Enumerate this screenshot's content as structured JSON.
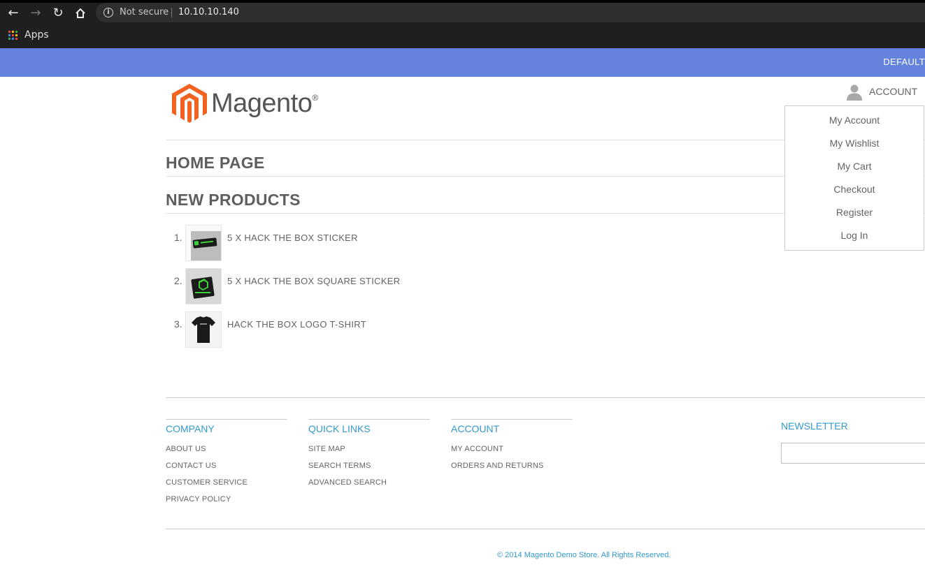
{
  "browser": {
    "security_label": "Not secure",
    "url": "10.10.10.140",
    "bookmarks": {
      "apps_label": "Apps"
    }
  },
  "header": {
    "store_language": "DEFAULT",
    "logo_text": "Magento",
    "logo_reg": "®",
    "account_label": "ACCOUNT"
  },
  "account_menu": [
    "My Account",
    "My Wishlist",
    "My Cart",
    "Checkout",
    "Register",
    "Log In"
  ],
  "main": {
    "page_title": "HOME PAGE",
    "section_title": "NEW PRODUCTS",
    "products": [
      {
        "index": "1.",
        "name": "5 X HACK THE BOX STICKER"
      },
      {
        "index": "2.",
        "name": "5 X HACK THE BOX SQUARE STICKER"
      },
      {
        "index": "3.",
        "name": "HACK THE BOX LOGO T-SHIRT"
      }
    ]
  },
  "footer": {
    "columns": [
      {
        "title": "COMPANY",
        "links": [
          "ABOUT US",
          "CONTACT US",
          "CUSTOMER SERVICE",
          "PRIVACY POLICY"
        ]
      },
      {
        "title": "QUICK LINKS",
        "links": [
          "SITE MAP",
          "SEARCH TERMS",
          "ADVANCED SEARCH"
        ]
      },
      {
        "title": "ACCOUNT",
        "links": [
          "MY ACCOUNT",
          "ORDERS AND RETURNS"
        ]
      }
    ],
    "newsletter_title": "NEWSLETTER",
    "copyright": "© 2014 Magento Demo Store. All Rights Reserved."
  },
  "colors": {
    "top_bar": "#6483dd",
    "link_blue": "#3399cc",
    "logo_orange": "#f26322",
    "text_gray": "#636363"
  }
}
